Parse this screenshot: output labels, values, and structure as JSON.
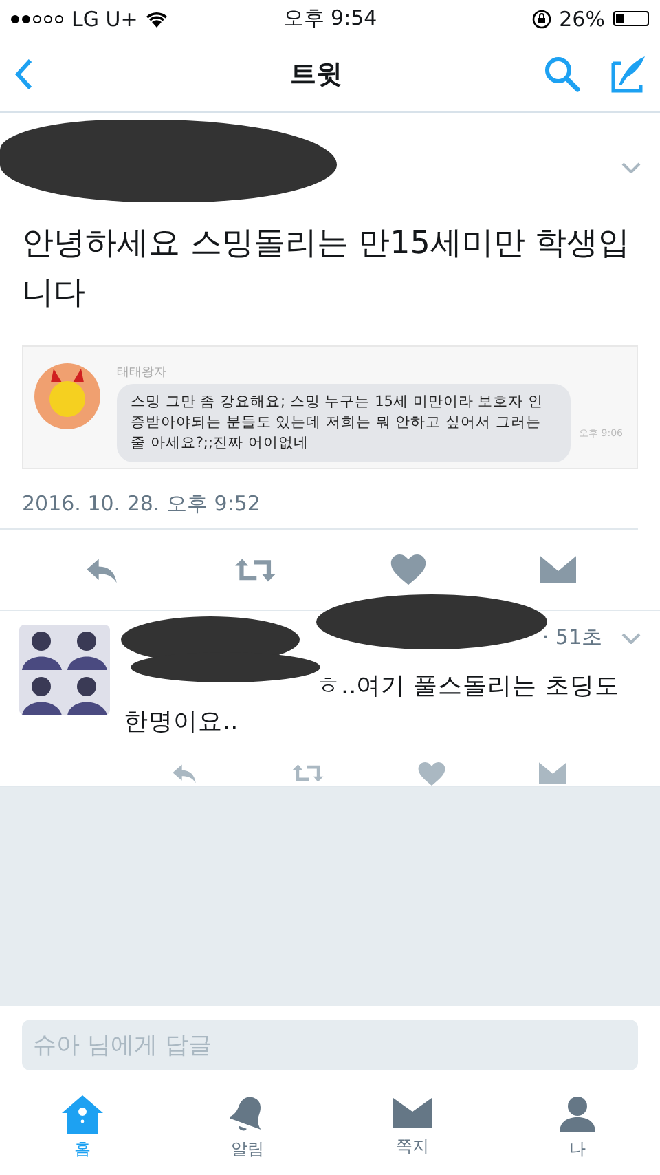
{
  "status_bar": {
    "carrier": "LG U+",
    "time": "오후 9:54",
    "battery": "26%"
  },
  "nav": {
    "title": "트윗"
  },
  "tweet": {
    "text": "안녕하세요 스밍돌리는 만15세미만 학생입니다",
    "embedded": {
      "sender": "태태왕자",
      "message": "스밍 그만 좀 강요해요; 스밍 누구는 15세 미만이라 보호자 인증받아야되는 분들도 있는데 저희는 뭐 안하고 싶어서 그러는 줄 아세요?;;진짜 어이없네",
      "time": "오후 9:06"
    },
    "date": "2016. 10. 28. 오후 9:52"
  },
  "reply": {
    "meta": "· 51초",
    "text": "ㅎ..여기 풀스돌리는 초딩도 한명이요.."
  },
  "reply_field": {
    "placeholder": "슈아 님에게 답글"
  },
  "tabs": [
    {
      "label": "홈",
      "selected": true
    },
    {
      "label": "알림",
      "selected": false
    },
    {
      "label": "쪽지",
      "selected": false
    },
    {
      "label": "나",
      "selected": false
    }
  ]
}
